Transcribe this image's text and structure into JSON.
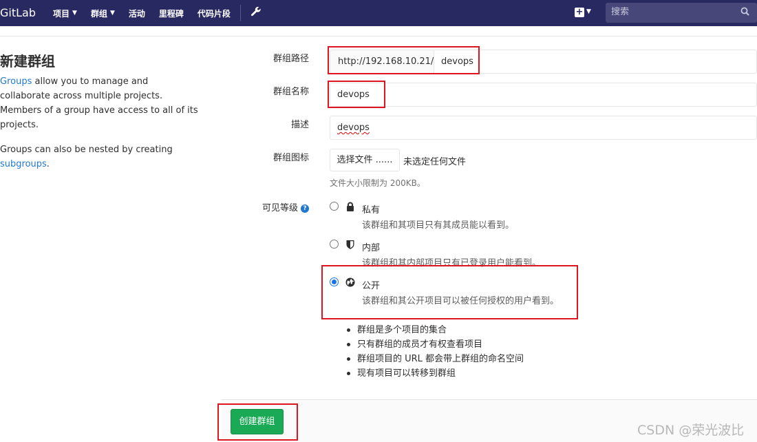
{
  "nav": {
    "brand": "GitLab",
    "items": [
      {
        "label": "项目",
        "dropdown": true
      },
      {
        "label": "群组",
        "dropdown": true
      },
      {
        "label": "活动",
        "dropdown": false
      },
      {
        "label": "里程碑",
        "dropdown": false
      },
      {
        "label": "代码片段",
        "dropdown": false
      }
    ],
    "search_placeholder": "搜索",
    "colors": {
      "bar": "#292961",
      "search": "#47477a"
    }
  },
  "page": {
    "title": "新建群组",
    "help": {
      "link_groups": "Groups",
      "para1_rest": " allow you to manage and collaborate across multiple projects. Members of a group have access to all of its projects.",
      "para2_start": "Groups can also be nested by creating ",
      "link_subgroups": "subgroups",
      "para2_end": "."
    }
  },
  "form": {
    "path_label": "群组路径",
    "path_prefix": "http://192.168.10.21/",
    "path_value": "devops",
    "name_label": "群组名称",
    "name_value": "devops",
    "desc_label": "描述",
    "desc_value": "devops",
    "avatar_label": "群组图标",
    "file_button": "选择文件 ......",
    "no_file": "未选定任何文件",
    "file_hint": "文件大小限制为 200KB。",
    "visibility_label": "可见等级",
    "visibility_options": [
      {
        "title": "私有",
        "desc": "该群组和其项目只有其成员能以看到。",
        "icon": "lock-icon",
        "checked": false
      },
      {
        "title": "内部",
        "desc": "该群组和其内部项目只有已登录用户能看到。",
        "icon": "shield-icon",
        "checked": false
      },
      {
        "title": "公开",
        "desc": "该群组和其公开项目可以被任何授权的用户看到。",
        "icon": "globe-icon",
        "checked": true
      }
    ],
    "bullets": [
      "群组是多个项目的集合",
      "只有群组的成员才有权查看项目",
      "群组项目的 URL 都会带上群组的命名空间",
      "现有项目可以转移到群组"
    ],
    "submit_label": "创建群组",
    "submit_color": "#1aaa55"
  },
  "watermark": "CSDN @荣光波比"
}
